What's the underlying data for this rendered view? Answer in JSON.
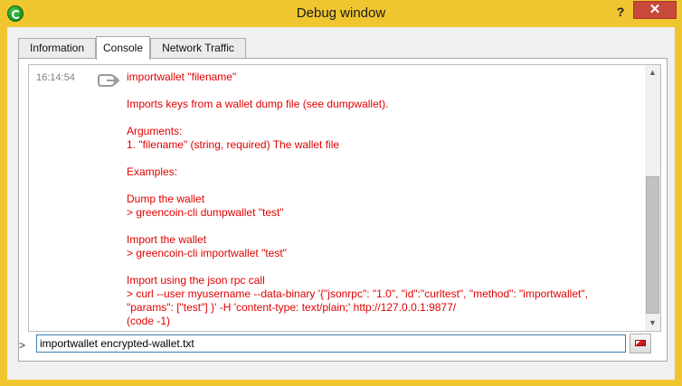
{
  "window": {
    "title": "Debug window",
    "help_label": "?",
    "close_label": "✕"
  },
  "tabs": [
    {
      "label": "Information"
    },
    {
      "label": "Console",
      "active": true
    },
    {
      "label": "Network Traffic"
    }
  ],
  "console": {
    "timestamp": "16:14:54",
    "output_lines": [
      "importwallet \"filename\"",
      "",
      "Imports keys from a wallet dump file (see dumpwallet).",
      "",
      "Arguments:",
      "1. \"filename\" (string, required) The wallet file",
      "",
      "Examples:",
      "",
      "Dump the wallet",
      "> greencoin-cli dumpwallet \"test\"",
      "",
      "Import the wallet",
      "> greencoin-cli importwallet \"test\"",
      "",
      "Import using the json rpc call",
      "> curl --user myusername --data-binary '{\"jsonrpc\": \"1.0\", \"id\":\"curltest\", \"method\": \"importwallet\",",
      "\"params\": [\"test\"] }' -H 'content-type: text/plain;' http://127.0.0.1:9877/",
      "(code -1)"
    ],
    "prompt": ">",
    "input_value": "importwallet encrypted-wallet.txt"
  },
  "colors": {
    "titlebar": "#f0c630",
    "error_text": "#e00000",
    "close_button": "#c7493b"
  }
}
